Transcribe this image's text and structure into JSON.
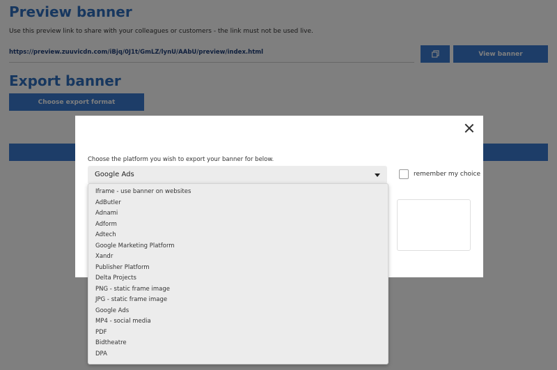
{
  "preview": {
    "title": "Preview banner",
    "description": "Use this preview link to share with your colleagues or customers - the link must not be used live.",
    "link": "https://preview.zuuvicdn.com/iBjq/0J1t/GmLZ/lynU/AAbU/preview/index.html",
    "view_button": "View banner",
    "copy_icon": "copy-icon"
  },
  "export": {
    "title": "Export banner",
    "choose_button": "Choose export format"
  },
  "modal": {
    "instruction": "Choose the platform you wish to export your banner for below.",
    "selected": "Google Ads",
    "remember_label": "remember my choice",
    "options": [
      "Iframe - use banner on websites",
      "AdButler",
      "Adnami",
      "Adform",
      "Adtech",
      "Google Marketing Platform",
      "Xandr",
      "Publisher Platform",
      "Delta Projects",
      "PNG - static frame image",
      "JPG - static frame image",
      "Google Ads",
      "MP4 - social media",
      "PDF",
      "Bidtheatre",
      "DPA"
    ]
  },
  "colors": {
    "accent": "#3a7bd0",
    "title": "#2f6fbf",
    "overlay": "rgba(0,0,0,0.5)"
  }
}
